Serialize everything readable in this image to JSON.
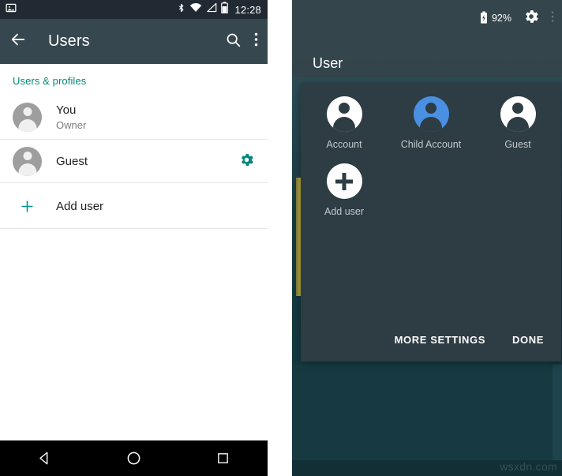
{
  "left_phone": {
    "status_bar": {
      "icons": [
        "image-icon",
        "bluetooth-icon",
        "wifi-icon",
        "cell-signal-icon",
        "battery-icon"
      ],
      "clock": "12:28"
    },
    "toolbar": {
      "back_label": "back-arrow",
      "title": "Users",
      "search_label": "search",
      "overflow_label": "more-options"
    },
    "section_header": "Users & profiles",
    "rows": [
      {
        "title": "You",
        "subtitle": "Owner",
        "avatar": "person-avatar",
        "trailing": ""
      },
      {
        "title": "Guest",
        "subtitle": "",
        "avatar": "person-avatar",
        "trailing": "gear-icon"
      }
    ],
    "add_user": {
      "label": "Add user",
      "icon": "plus-icon"
    },
    "nav_bar": {
      "back": "back-triangle",
      "home": "home-circle",
      "recents": "recents-square"
    },
    "colors": {
      "accent": "#00897b",
      "toolbar": "#37474f",
      "status_bar": "#212a33"
    }
  },
  "right_phone": {
    "status_bar": {
      "battery_icon": "battery-charging-icon",
      "battery_percent": "92%",
      "settings_icon": "gear-icon",
      "overflow_icon": "more-options-icon"
    },
    "heading": "User",
    "dialog": {
      "tiles": [
        {
          "label": "Account",
          "icon": "person-icon",
          "highlighted": false
        },
        {
          "label": "Child Account",
          "icon": "person-icon",
          "highlighted": true
        },
        {
          "label": "Guest",
          "icon": "person-icon",
          "highlighted": false
        },
        {
          "label": "Add user",
          "icon": "plus-icon",
          "highlighted": false
        }
      ],
      "actions": [
        {
          "label": "MORE SETTINGS"
        },
        {
          "label": "DONE"
        }
      ]
    },
    "colors": {
      "dialog_bg": "#2e3c43",
      "highlight": "#4a90e2",
      "wallpaper": "#173a42"
    }
  },
  "watermark": "wsxdn.com"
}
